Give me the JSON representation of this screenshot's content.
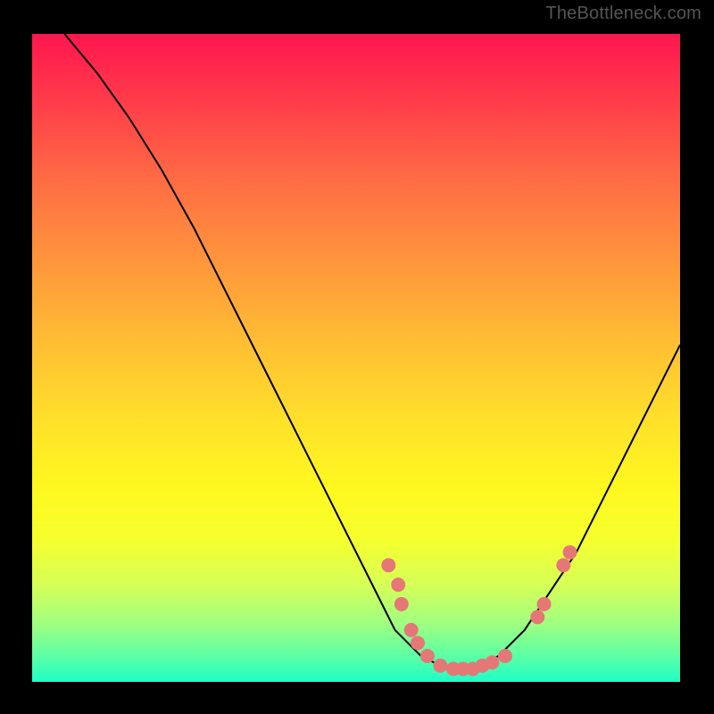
{
  "watermark": "TheBottleneck.com",
  "chart_data": {
    "type": "line",
    "title": "",
    "xlabel": "",
    "ylabel": "",
    "xlim": [
      0,
      100
    ],
    "ylim": [
      0,
      100
    ],
    "gradient_colors": [
      "#ff164f",
      "#ffe12a",
      "#1effc8"
    ],
    "curve": [
      {
        "x": 5,
        "y": 100
      },
      {
        "x": 10,
        "y": 94
      },
      {
        "x": 15,
        "y": 87
      },
      {
        "x": 20,
        "y": 79
      },
      {
        "x": 25,
        "y": 70
      },
      {
        "x": 30,
        "y": 60
      },
      {
        "x": 35,
        "y": 50
      },
      {
        "x": 40,
        "y": 40
      },
      {
        "x": 45,
        "y": 30
      },
      {
        "x": 50,
        "y": 20
      },
      {
        "x": 53,
        "y": 14
      },
      {
        "x": 56,
        "y": 8
      },
      {
        "x": 60,
        "y": 4
      },
      {
        "x": 64,
        "y": 2
      },
      {
        "x": 68,
        "y": 2
      },
      {
        "x": 72,
        "y": 4
      },
      {
        "x": 76,
        "y": 8
      },
      {
        "x": 80,
        "y": 14
      },
      {
        "x": 84,
        "y": 20
      },
      {
        "x": 88,
        "y": 28
      },
      {
        "x": 92,
        "y": 36
      },
      {
        "x": 96,
        "y": 44
      },
      {
        "x": 100,
        "y": 52
      }
    ],
    "points": [
      {
        "x": 55,
        "y": 18
      },
      {
        "x": 56.5,
        "y": 15
      },
      {
        "x": 57,
        "y": 12
      },
      {
        "x": 58.5,
        "y": 8
      },
      {
        "x": 59.5,
        "y": 6
      },
      {
        "x": 61,
        "y": 4
      },
      {
        "x": 63,
        "y": 2.5
      },
      {
        "x": 65,
        "y": 2
      },
      {
        "x": 66.5,
        "y": 2
      },
      {
        "x": 68,
        "y": 2
      },
      {
        "x": 69.5,
        "y": 2.5
      },
      {
        "x": 71,
        "y": 3
      },
      {
        "x": 73,
        "y": 4
      },
      {
        "x": 78,
        "y": 10
      },
      {
        "x": 79,
        "y": 12
      },
      {
        "x": 82,
        "y": 18
      },
      {
        "x": 83,
        "y": 20
      }
    ],
    "point_color": "#e67777",
    "curve_color": "#000000"
  }
}
